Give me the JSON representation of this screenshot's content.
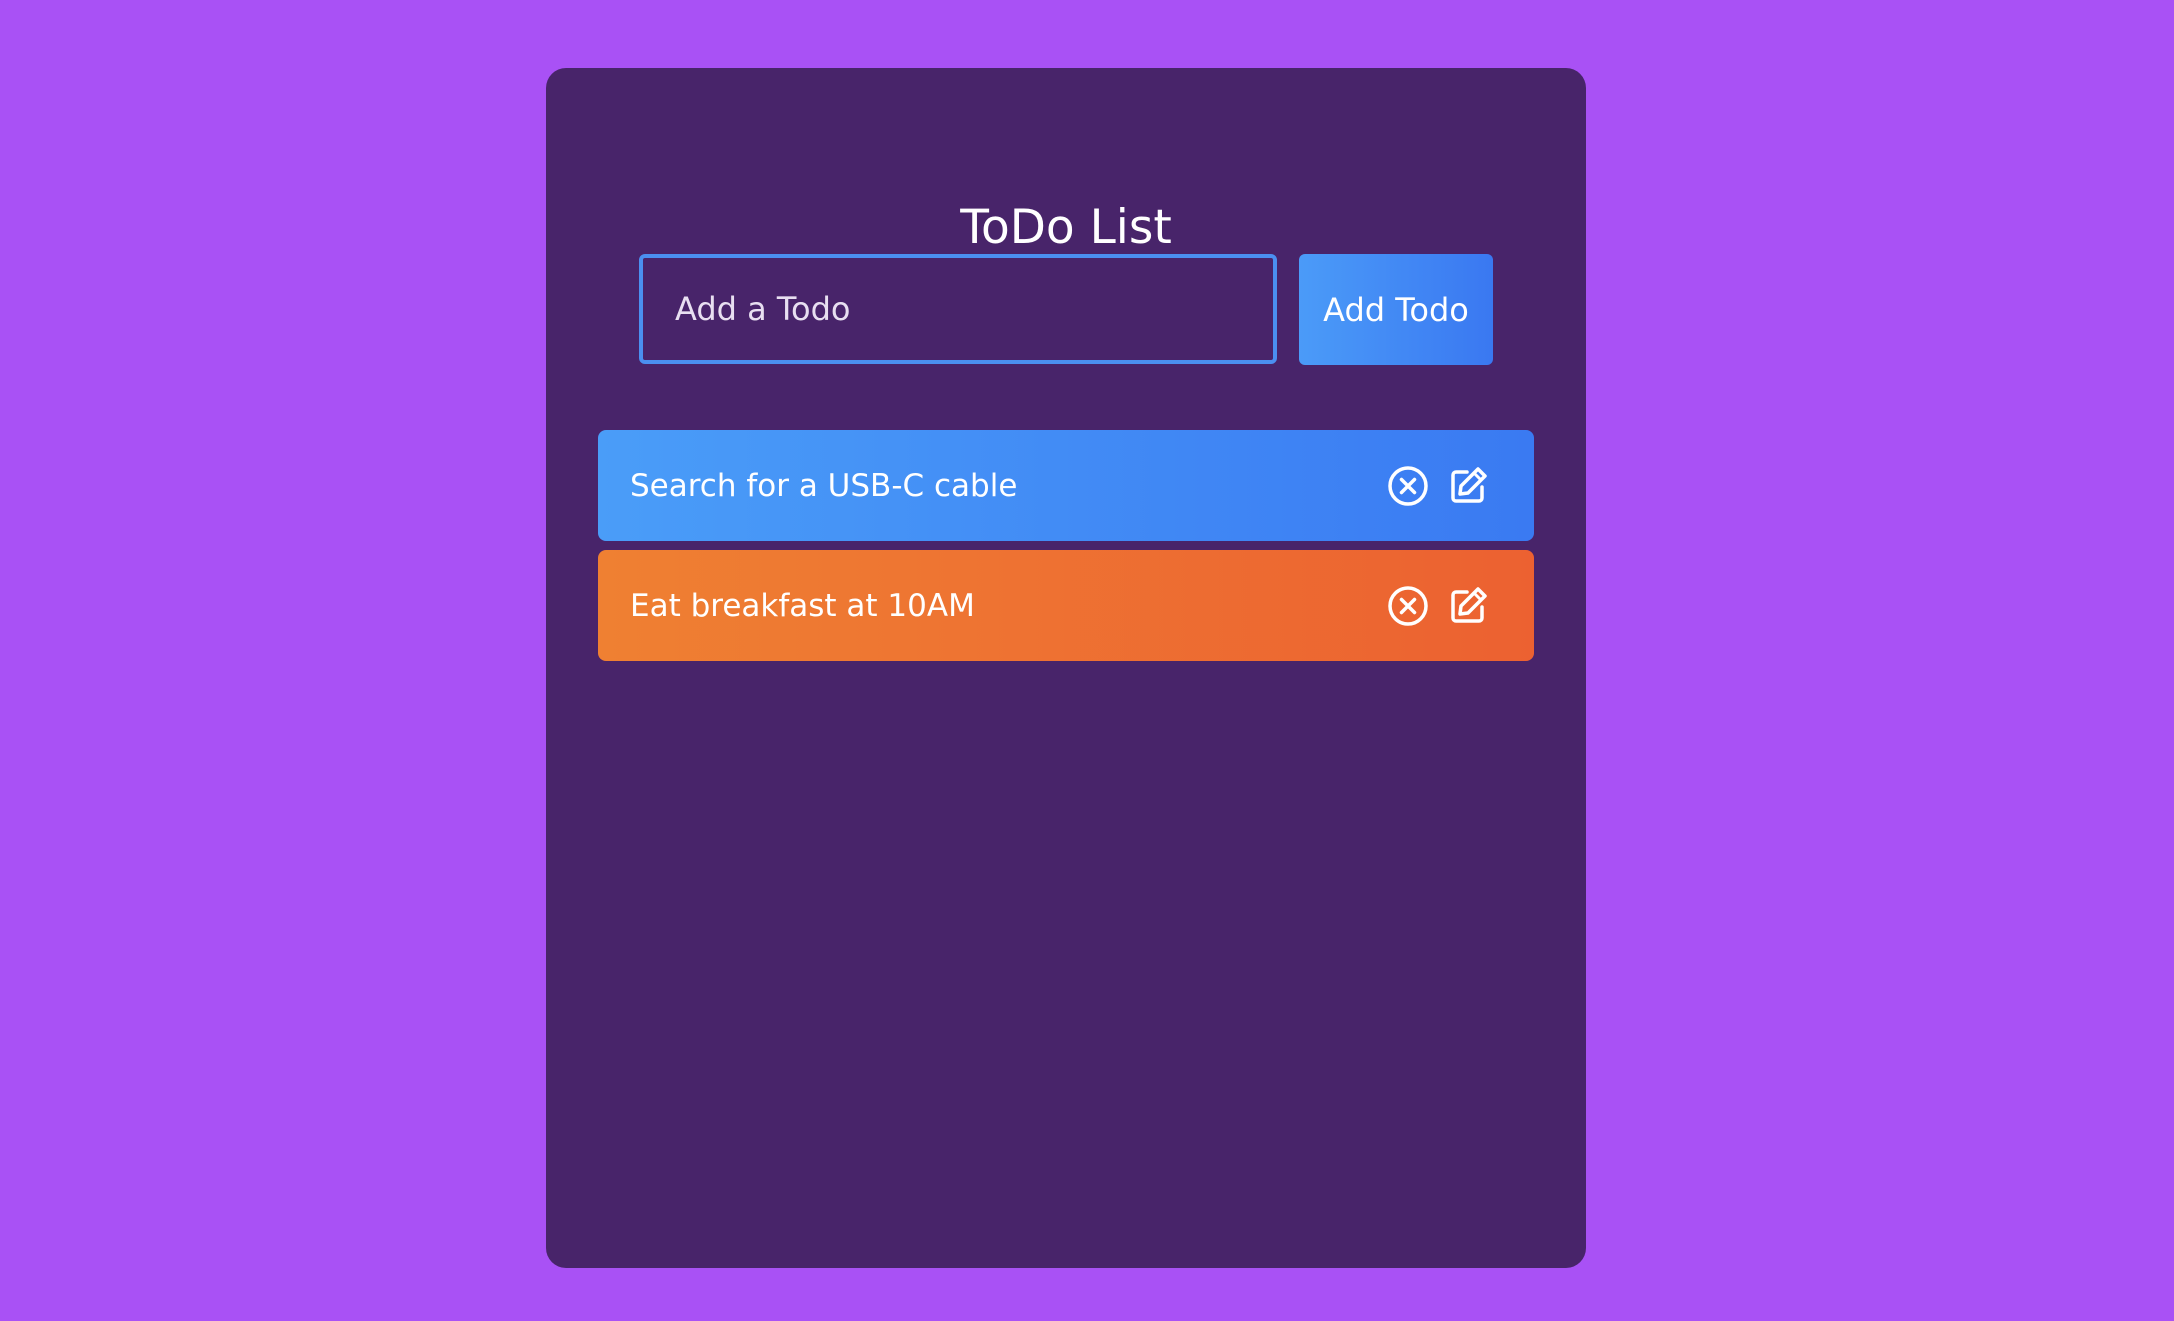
{
  "app": {
    "title": "ToDo List"
  },
  "form": {
    "input_value": "",
    "input_placeholder": "Add a Todo",
    "add_button_label": "Add Todo"
  },
  "todos": [
    {
      "text": "Search for a USB-C cable",
      "color": "#4a9df8"
    },
    {
      "text": "Eat breakfast at 10AM",
      "color": "#ef8032"
    }
  ],
  "icons": {
    "delete": "close-circle-icon",
    "edit": "edit-icon"
  },
  "colors": {
    "page_background": "#a951f5",
    "card_background": "#48246a",
    "accent_blue": "#3a78f1",
    "accent_orange": "#ec6131",
    "input_border": "#4b8ff0"
  }
}
